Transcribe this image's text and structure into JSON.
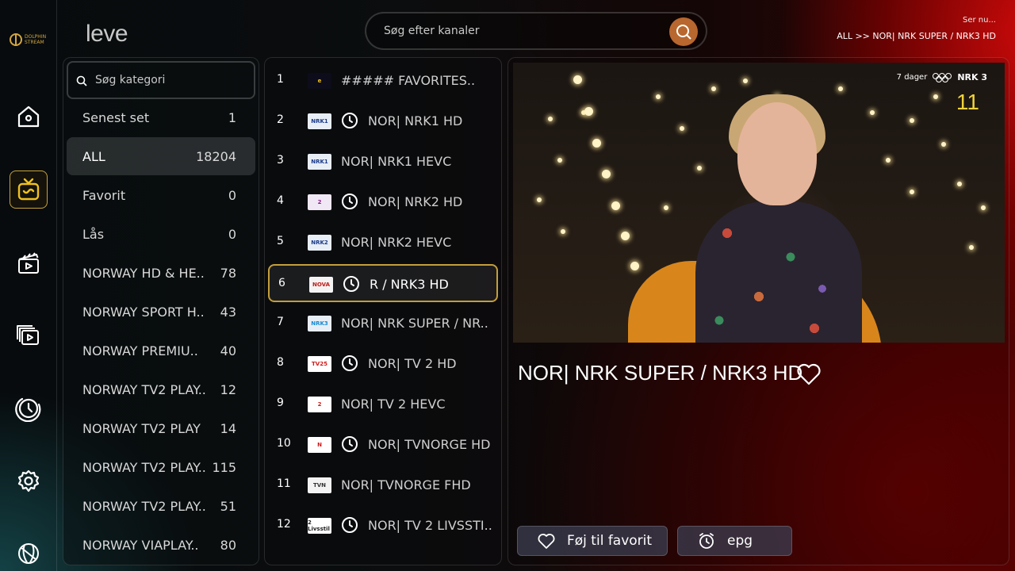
{
  "app": {
    "brand": "leve"
  },
  "search": {
    "placeholder": "Søg efter kanaler"
  },
  "now_playing": {
    "label": "Ser nu...",
    "breadcrumb": "ALL >> NOR| NRK SUPER / NRK3 HD"
  },
  "sidebar": {
    "logo_text": "DOLPHIN STREAM",
    "items": [
      {
        "name": "home",
        "icon": "home-icon"
      },
      {
        "name": "live-tv",
        "icon": "tv-icon",
        "active": true
      },
      {
        "name": "movies",
        "icon": "clapperboard-icon"
      },
      {
        "name": "series",
        "icon": "series-icon"
      },
      {
        "name": "catch-up",
        "icon": "replay-clock-icon"
      },
      {
        "name": "settings",
        "icon": "gear-icon"
      },
      {
        "name": "sports",
        "icon": "ball-icon"
      }
    ]
  },
  "categories": {
    "search_placeholder": "Søg kategori",
    "items": [
      {
        "label": "Senest set",
        "count": "1"
      },
      {
        "label": "ALL",
        "count": "18204",
        "active": true
      },
      {
        "label": "Favorit",
        "count": "0"
      },
      {
        "label": "Lås",
        "count": "0"
      },
      {
        "label": "NORWAY HD & HE..",
        "count": "78"
      },
      {
        "label": "NORWAY SPORT H..",
        "count": "43"
      },
      {
        "label": "NORWAY PREMIU..",
        "count": "40"
      },
      {
        "label": "NORWAY TV2 PLAY..",
        "count": "12"
      },
      {
        "label": "NORWAY TV2 PLAY",
        "count": "14"
      },
      {
        "label": "NORWAY TV2 PLAY..",
        "count": "115"
      },
      {
        "label": "NORWAY TV2 PLAY..",
        "count": "51"
      },
      {
        "label": "NORWAY VIAPLAY..",
        "count": "80"
      }
    ]
  },
  "channels": [
    {
      "num": "1",
      "name": "##### FAVORITES..",
      "logo": "e",
      "logo_bg": "#0c0c1a",
      "logo_fg": "#f0c020",
      "epg": false
    },
    {
      "num": "2",
      "name": "NOR| NRK1 HD",
      "logo": "NRK1",
      "logo_bg": "#e8eef5",
      "logo_fg": "#1a3a8a",
      "epg": true
    },
    {
      "num": "3",
      "name": "NOR| NRK1 HEVC",
      "logo": "NRK1",
      "logo_bg": "#e8eef5",
      "logo_fg": "#1a3a8a",
      "epg": false
    },
    {
      "num": "4",
      "name": "NOR| NRK2 HD",
      "logo": "2",
      "logo_bg": "#f0e8f5",
      "logo_fg": "#8a1a8a",
      "epg": true
    },
    {
      "num": "5",
      "name": "NOR| NRK2 HEVC",
      "logo": "NRK2",
      "logo_bg": "#e8eef5",
      "logo_fg": "#1a3a8a",
      "epg": false
    },
    {
      "num": "6",
      "name": "R / NRK3 HD",
      "logo": "NOVA",
      "logo_bg": "#f3f3f3",
      "logo_fg": "#c01a1a",
      "epg": true,
      "active": true
    },
    {
      "num": "7",
      "name": "NOR| NRK SUPER / NR..",
      "logo": "NRK3",
      "logo_bg": "#e8eef5",
      "logo_fg": "#1a8ad0",
      "epg": false
    },
    {
      "num": "8",
      "name": "NOR| TV 2 HD",
      "logo": "TV25",
      "logo_bg": "#ffffff",
      "logo_fg": "#d01a1a",
      "epg": true
    },
    {
      "num": "9",
      "name": "NOR| TV 2 HEVC",
      "logo": "2",
      "logo_bg": "#ffffff",
      "logo_fg": "#d01a1a",
      "epg": false
    },
    {
      "num": "10",
      "name": "NOR| TVNORGE HD",
      "logo": "N",
      "logo_bg": "#ffffff",
      "logo_fg": "#d01a1a",
      "epg": true
    },
    {
      "num": "11",
      "name": "NOR| TVNORGE FHD",
      "logo": "TVN",
      "logo_bg": "#f3f3f3",
      "logo_fg": "#333333",
      "epg": false
    },
    {
      "num": "12",
      "name": "NOR| TV 2 LIVSSTI..",
      "logo": "2 Livsstil",
      "logo_bg": "#ffffff",
      "logo_fg": "#222222",
      "epg": true
    }
  ],
  "preview": {
    "title": "NOR| NRK SUPER / NRK3 HD",
    "overlay_days": "7 dager",
    "overlay_channel": "NRK 3",
    "overlay_number": "11"
  },
  "actions": {
    "favorite_label": "Føj til favorit",
    "epg_label": "epg"
  },
  "colors": {
    "accent_gold": "#c39e3b",
    "search_button": "#b8672e",
    "overlay_number": "#f0d23a"
  }
}
